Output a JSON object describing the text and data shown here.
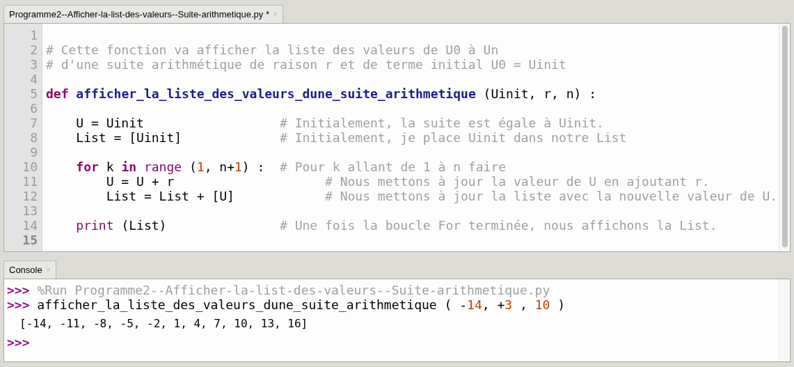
{
  "editor": {
    "tab": {
      "label": "Programme2--Afficher-la-list-des-valeurs--Suite-arithmetique.py *",
      "close": "×",
      "selected": true
    },
    "lines": [
      {
        "number": "1",
        "current": false
      },
      {
        "number": "2",
        "current": false,
        "tokens": [
          {
            "kind": "comment",
            "text": "# Cette fonction va afficher la liste des valeurs de U0 à Un"
          }
        ]
      },
      {
        "number": "3",
        "current": false,
        "tokens": [
          {
            "kind": "comment",
            "text": "# d'une suite arithmétique de raison r et de terme initial U0 = Uinit"
          }
        ]
      },
      {
        "number": "4",
        "current": false
      },
      {
        "number": "5",
        "current": false,
        "tokens": [
          {
            "kind": "keyword",
            "text": "def "
          },
          {
            "kind": "function",
            "text": "afficher_la_liste_des_valeurs_dune_suite_arithmetique"
          },
          {
            "kind": "plain",
            "text": " (Uinit, r, n) :"
          }
        ]
      },
      {
        "number": "6",
        "current": false
      },
      {
        "number": "7",
        "current": false,
        "tokens": [
          {
            "kind": "plain",
            "text": "    U = Uinit                  "
          },
          {
            "kind": "comment",
            "text": "# Initialement, la suite est égale à Uinit."
          }
        ]
      },
      {
        "number": "8",
        "current": false,
        "tokens": [
          {
            "kind": "plain",
            "text": "    List = [Uinit]             "
          },
          {
            "kind": "comment",
            "text": "# Initialement, je place Uinit dans notre List"
          }
        ]
      },
      {
        "number": "9",
        "current": false
      },
      {
        "number": "10",
        "current": false,
        "tokens": [
          {
            "kind": "keyword",
            "text": "    for"
          },
          {
            "kind": "plain",
            "text": " k "
          },
          {
            "kind": "keyword",
            "text": "in"
          },
          {
            "kind": "builtin",
            "text": " range"
          },
          {
            "kind": "plain",
            "text": " ("
          },
          {
            "kind": "number",
            "text": "1"
          },
          {
            "kind": "plain",
            "text": ", n+"
          },
          {
            "kind": "number",
            "text": "1"
          },
          {
            "kind": "plain",
            "text": ") :  "
          },
          {
            "kind": "comment",
            "text": "# Pour k allant de 1 à n faire"
          }
        ]
      },
      {
        "number": "11",
        "current": false,
        "tokens": [
          {
            "kind": "plain",
            "text": "        U = U + r                    "
          },
          {
            "kind": "comment",
            "text": "# Nous mettons à jour la valeur de U en ajoutant r."
          }
        ]
      },
      {
        "number": "12",
        "current": false,
        "tokens": [
          {
            "kind": "plain",
            "text": "        List = List + [U]            "
          },
          {
            "kind": "comment",
            "text": "# Nous mettons à jour la liste avec la nouvelle valeur de U."
          }
        ]
      },
      {
        "number": "13",
        "current": false
      },
      {
        "number": "14",
        "current": false,
        "tokens": [
          {
            "kind": "builtin",
            "text": "    print"
          },
          {
            "kind": "plain",
            "text": " (List)               "
          },
          {
            "kind": "comment",
            "text": "# Une fois la boucle For terminée, nous affichons la List."
          }
        ]
      },
      {
        "number": "15",
        "current": true
      }
    ]
  },
  "console": {
    "tab": {
      "label": "Console",
      "close": "×",
      "selected": true
    },
    "lines": [
      {
        "kind": "input",
        "tokens": [
          {
            "kind": "prompt",
            "text": ">>>"
          },
          {
            "kind": "magic",
            "text": " %Run Programme2--Afficher-la-list-des-valeurs--Suite-arithmetique.py"
          }
        ]
      },
      {
        "kind": "input",
        "tokens": [
          {
            "kind": "prompt",
            "text": ">>>"
          },
          {
            "kind": "plain",
            "text": " afficher_la_liste_des_valeurs_dune_suite_arithmetique ( -"
          },
          {
            "kind": "number",
            "text": "14"
          },
          {
            "kind": "plain",
            "text": ", +"
          },
          {
            "kind": "number",
            "text": "3"
          },
          {
            "kind": "plain",
            "text": " , "
          },
          {
            "kind": "number",
            "text": "10"
          },
          {
            "kind": "plain",
            "text": " )"
          }
        ]
      },
      {
        "kind": "output",
        "tokens": [
          {
            "kind": "plain",
            "text": "[-14, -11, -8, -5, -2, 1, 4, 7, 10, 13, 16]"
          }
        ]
      },
      {
        "kind": "input",
        "tokens": [
          {
            "kind": "prompt",
            "text": ">>>"
          }
        ]
      }
    ]
  }
}
